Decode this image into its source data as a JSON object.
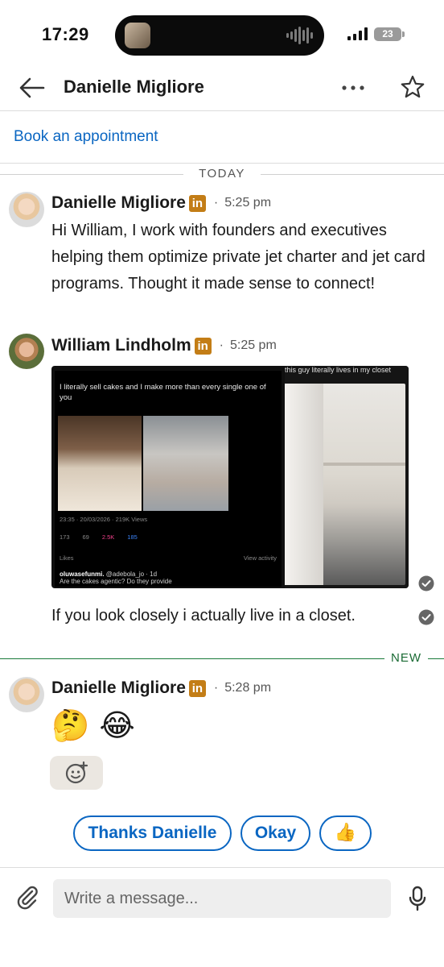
{
  "status_bar": {
    "time": "17:29",
    "battery": "23"
  },
  "header": {
    "title": "Danielle Migliore"
  },
  "book_appointment": "Book an appointment",
  "day_separator": "TODAY",
  "messages": [
    {
      "sender": "Danielle Migliore",
      "badge": "in",
      "time": "5:25 pm",
      "text": "Hi William, I work with founders and executives helping them optimize private jet charter and jet card programs. Thought it made sense to connect!"
    },
    {
      "sender": "William Lindholm",
      "badge": "in",
      "time": "5:25 pm",
      "image": {
        "tweet_text": "I literally sell cakes and I make more than every single one of you",
        "tweet_meta": "23:35 · 20/03/2026 · 219K Views",
        "stats": {
          "replies": "173",
          "reposts": "69",
          "likes": "2.5K",
          "bookmarks": "185"
        },
        "likes_label": "Likes",
        "view_activity": "View activity",
        "reply_user": "oluwasefunmi.",
        "reply_handle": "@adebola_jo · 1d",
        "reply_text": "Are the cakes agentic? Do they provide",
        "closet_caption": "this guy literally lives in my closet"
      },
      "text": "If you look closely i actually live in a closet."
    },
    {
      "sender": "Danielle Migliore",
      "badge": "in",
      "time": "5:28 pm",
      "emojis": "🤔 😂"
    }
  ],
  "new_separator": "NEW",
  "suggestions": [
    "Thanks Danielle",
    "Okay",
    "👍"
  ],
  "composer": {
    "placeholder": "Write a message..."
  },
  "colors": {
    "link": "#0a66c2",
    "badge": "#c37d16",
    "new_line": "#1a7a3a"
  }
}
